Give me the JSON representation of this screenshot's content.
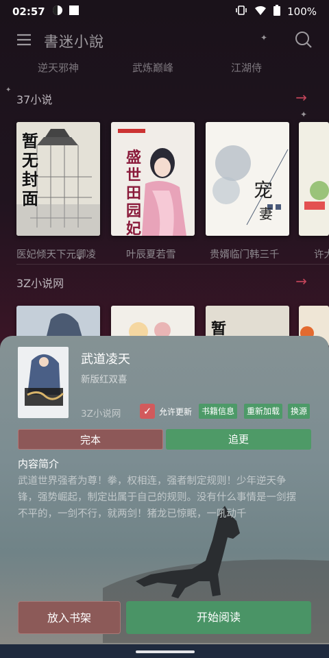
{
  "status_bar": {
    "time": "02:57",
    "battery": "100%"
  },
  "app_bar": {
    "title": "書迷小說"
  },
  "tabs": [
    "逆天邪神",
    "武炼巅峰",
    "江湖侍"
  ],
  "sections": [
    {
      "title": "37小说",
      "books": [
        {
          "title": "医妃倾天下元卿凌",
          "cover_text": "暂无封面"
        },
        {
          "title": "叶辰夏若雪",
          "cover_text": "盛世田园妃"
        },
        {
          "title": "贵婿临门韩三千",
          "cover_text": "宠妻"
        },
        {
          "title": "许大"
        }
      ]
    },
    {
      "title": "3Z小说网",
      "books": [
        {
          "title": ""
        },
        {
          "title": ""
        },
        {
          "title": "",
          "cover_text": "暂"
        },
        {
          "title": ""
        }
      ]
    }
  ],
  "sheet": {
    "title": "武道凌天",
    "author": "新版红双喜",
    "source": "3Z小说网",
    "allow_update_label": "允许更新",
    "chips": [
      "书籍信息",
      "重新加载",
      "换源"
    ],
    "status_label": "完本",
    "follow_label": "追更",
    "intro_heading": "内容简介",
    "intro_text": "武道世界强者为尊！拳，权相连，强者制定规则！少年逆天争锋，强势崛起，制定出属于自己的规则。没有什么事情是一剑摆不平的，一剑不行，就两剑！猪龙已惊眠，一吼动千",
    "add_shelf_label": "放入书架",
    "start_read_label": "开始阅读"
  },
  "colors": {
    "accent_red": "#c4455a",
    "chip_green": "#4d9a68",
    "status_red": "#8d5858",
    "read_green": "#4a9466"
  }
}
